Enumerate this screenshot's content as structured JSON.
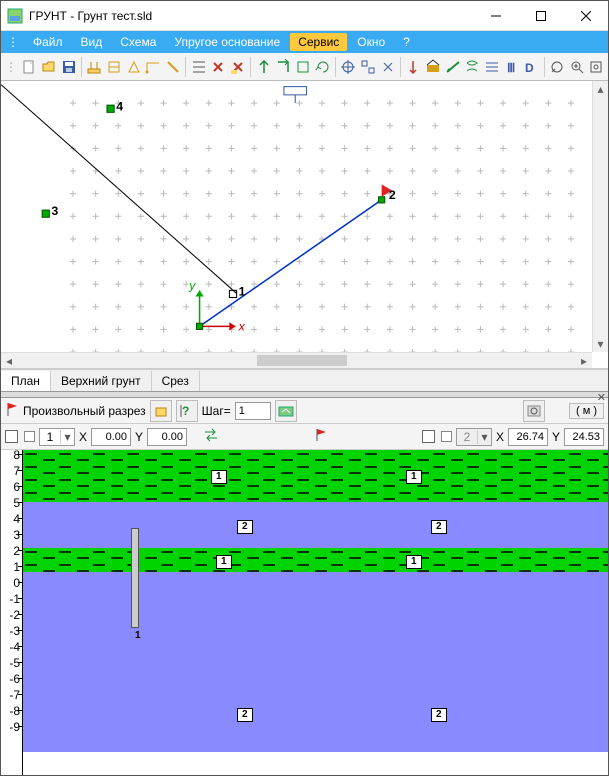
{
  "titlebar": {
    "title": "ГРУНТ - Грунт тест.sld"
  },
  "menu": {
    "items": [
      "Файл",
      "Вид",
      "Схема",
      "Упругое основание",
      "Сервис",
      "Окно",
      "?"
    ],
    "active_index": 4
  },
  "plan_tabs": {
    "items": [
      "План",
      "Верхний грунт",
      "Срез"
    ],
    "active_index": 0
  },
  "plan_points": {
    "p1": {
      "label": "1"
    },
    "p2": {
      "label": "2"
    },
    "p3": {
      "label": "3"
    },
    "p4": {
      "label": "4"
    },
    "axis_x": "x",
    "axis_y": "y"
  },
  "section": {
    "title": "Произвольный разрез",
    "step_label": "Шаг=",
    "step_value": "1",
    "unit_label": "(  м  )",
    "left": {
      "combo": "1",
      "x_label": "X",
      "x_value": "0.00",
      "y_label": "Y",
      "y_value": "0.00"
    },
    "right": {
      "combo": "2",
      "x_label": "X",
      "x_value": "26.74",
      "y_label": "Y",
      "y_value": "24.53"
    },
    "chart_data": {
      "type": "section",
      "y_ticks": [
        8,
        7,
        6,
        5,
        4,
        3,
        2,
        1,
        0,
        -1,
        -2,
        -3,
        -4,
        -5,
        -6,
        -7,
        -8,
        -9
      ],
      "layers": [
        {
          "id": "1",
          "material": "green-dashed",
          "top": 8,
          "bottom": 4.4
        },
        {
          "id": "2",
          "material": "blue",
          "top": 4.4,
          "bottom": 1.5
        },
        {
          "id": "1",
          "material": "green-dashed",
          "top": 1.5,
          "bottom": 0.2
        },
        {
          "id": "2",
          "material": "blue",
          "top": 0.2,
          "bottom": -9
        }
      ],
      "layer_labels": [
        {
          "text": "1",
          "x_frac": 0.33,
          "y": 6.2
        },
        {
          "text": "1",
          "x_frac": 0.67,
          "y": 6.2
        },
        {
          "text": "2",
          "x_frac": 0.4,
          "y": 3.0
        },
        {
          "text": "2",
          "x_frac": 0.7,
          "y": 3.0
        },
        {
          "text": "1",
          "x_frac": 0.35,
          "y": 0.85
        },
        {
          "text": "1",
          "x_frac": 0.67,
          "y": 0.85
        },
        {
          "text": "2",
          "x_frac": 0.4,
          "y": -8.6
        },
        {
          "text": "2",
          "x_frac": 0.7,
          "y": -8.6
        }
      ],
      "piles": [
        {
          "id": "1",
          "x_frac": 0.22,
          "top": 2.5,
          "bottom": -4.2
        }
      ]
    }
  }
}
